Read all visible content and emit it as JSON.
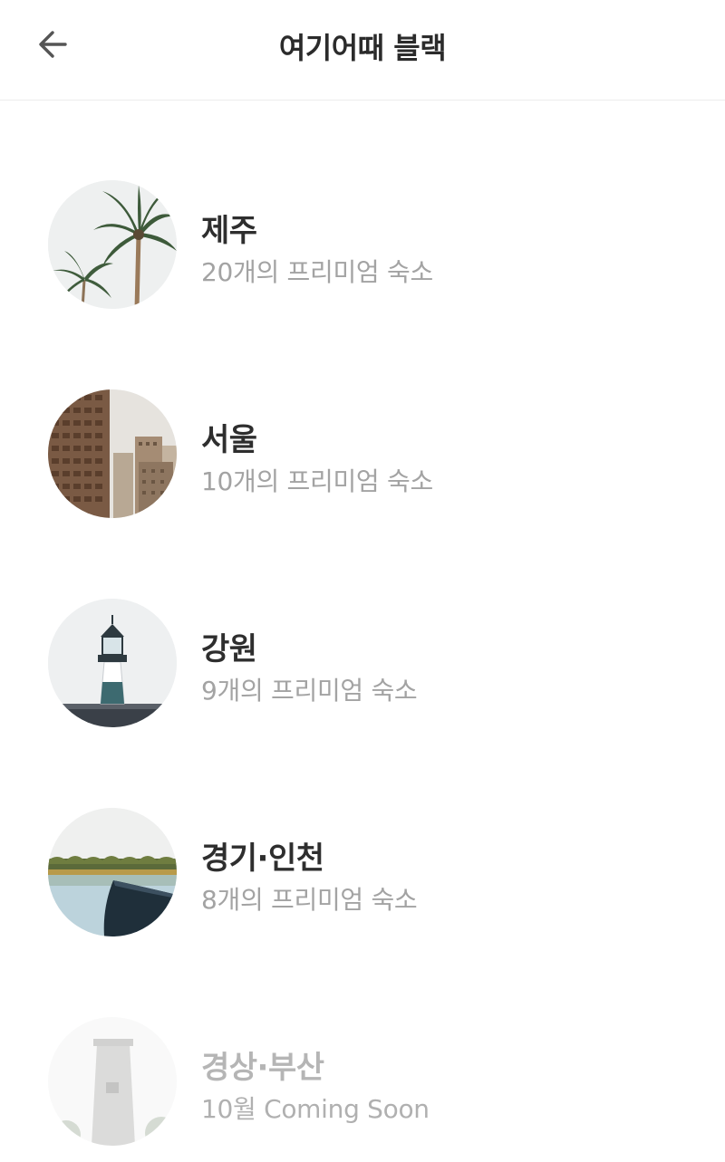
{
  "header": {
    "title": "여기어때 블랙",
    "back_icon": "arrow-left-icon"
  },
  "regions": [
    {
      "name": "제주",
      "subtitle": "20개의 프리미엄 숙소",
      "image": "palm-trees",
      "enabled": true
    },
    {
      "name": "서울",
      "subtitle": "10개의 프리미엄 숙소",
      "image": "city-buildings",
      "enabled": true
    },
    {
      "name": "강원",
      "subtitle": "9개의 프리미엄 숙소",
      "image": "lighthouse",
      "enabled": true
    },
    {
      "name": "경기·인천",
      "subtitle": "8개의 프리미엄 숙소",
      "image": "lake-boat",
      "enabled": true
    },
    {
      "name": "경상·부산",
      "subtitle": "10월 Coming Soon",
      "image": "stone-tower",
      "enabled": false
    }
  ],
  "colors": {
    "title": "#2b2b2b",
    "region_name": "#2e2e2e",
    "region_sub": "#a3a3a3",
    "disabled": "#b5b5b5",
    "divider": "#ececec"
  }
}
